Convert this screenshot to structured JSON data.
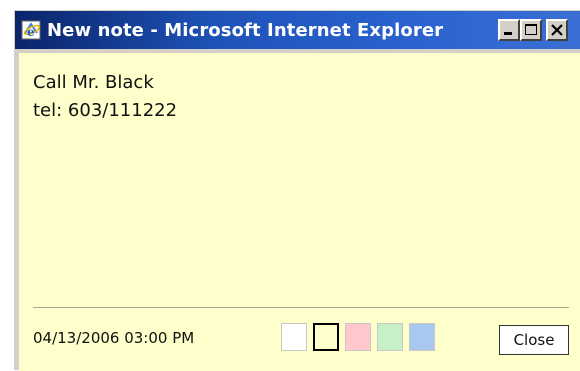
{
  "window": {
    "title": "New note - Microsoft Internet Explorer",
    "controls": {
      "minimize": "minimize",
      "maximize": "maximize",
      "close": "close"
    }
  },
  "note": {
    "lines": [
      "Call Mr. Black",
      "tel: 603/111222"
    ],
    "background_color": "#ffffcc"
  },
  "footer": {
    "datetime": "04/13/2006 03:00 PM",
    "swatches": [
      {
        "name": "white",
        "color": "#ffffff",
        "selected": false
      },
      {
        "name": "yellow",
        "color": "#ffffcc",
        "selected": true
      },
      {
        "name": "pink",
        "color": "#ffc8cc",
        "selected": false
      },
      {
        "name": "green",
        "color": "#c8f0c8",
        "selected": false
      },
      {
        "name": "blue",
        "color": "#a8c8f0",
        "selected": false
      }
    ],
    "close_label": "Close"
  }
}
